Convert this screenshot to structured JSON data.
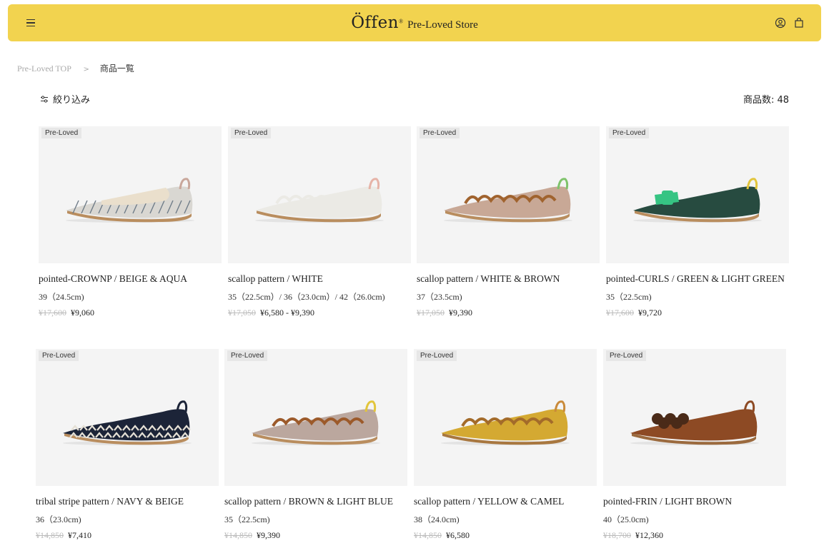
{
  "header": {
    "brand": "Öffen",
    "brand_mark": "®",
    "subtitle": "Pre-Loved Store",
    "bg_color": "#f2d34f"
  },
  "breadcrumb": {
    "home": "Pre-Loved TOP",
    "separator": ">",
    "current": "商品一覧"
  },
  "toolbar": {
    "filter_label": "絞り込み",
    "count_label": "商品数: 48"
  },
  "products": [
    {
      "badge": "Pre-Loved",
      "name": "pointed-CROWNP / BEIGE & AQUA",
      "size": "39（24.5cm)",
      "orig_price": "¥17,600",
      "price": "¥9,060",
      "shoe": "pointed",
      "upper": "#d9d7d2",
      "stripe": "#6f7c88",
      "trim": "#eadfcc",
      "sole": "#b98d5e",
      "tab": "#c9a79b",
      "accent": "none"
    },
    {
      "badge": "Pre-Loved",
      "name": "scallop pattern / WHITE",
      "size": "35（22.5cm）/ 36（23.0cm）/ 42（26.0cm)",
      "orig_price": "¥17,050",
      "price": "¥6,580 - ¥9,390",
      "shoe": "scallop",
      "upper": "#ebeae5",
      "stripe": "#ebeae5",
      "trim": "#ebeae5",
      "sole": "#b98d5e",
      "tab": "#e6b3a7",
      "accent": "none"
    },
    {
      "badge": "Pre-Loved",
      "name": "scallop pattern / WHITE & BROWN",
      "size": "37（23.5cm)",
      "orig_price": "¥17,050",
      "price": "¥9,390",
      "shoe": "scallop",
      "upper": "#c8a896",
      "stripe": "#c8a896",
      "trim": "#a0632e",
      "sole": "#b98d5e",
      "tab": "#7fc36b",
      "accent": "none"
    },
    {
      "badge": "Pre-Loved",
      "name": "pointed-CURLS / GREEN & LIGHT GREEN",
      "size": "35（22.5cm)",
      "orig_price": "¥17,600",
      "price": "¥9,720",
      "shoe": "bow",
      "upper": "#274b40",
      "stripe": "#274b40",
      "trim": "#274b40",
      "sole": "#b98d5e",
      "tab": "#e2c53b",
      "accent": "#36c483"
    },
    {
      "badge": "Pre-Loved",
      "name": "tribal stripe pattern / NAVY & BEIGE",
      "size": "36（23.0cm)",
      "orig_price": "¥14,850",
      "price": "¥7,410",
      "shoe": "zigzag",
      "upper": "#1c2438",
      "stripe": "#e5e0d5",
      "trim": "#1c2438",
      "sole": "#b98d5e",
      "tab": "#1c2438",
      "accent": "none"
    },
    {
      "badge": "Pre-Loved",
      "name": "scallop pattern / BROWN & LIGHT BLUE",
      "size": "35（22.5cm)",
      "orig_price": "¥14,850",
      "price": "¥9,390",
      "shoe": "scallop",
      "upper": "#bba79e",
      "stripe": "#bba79e",
      "trim": "#9c5a2a",
      "sole": "#b98d5e",
      "tab": "#e2c53b",
      "accent": "none"
    },
    {
      "badge": "Pre-Loved",
      "name": "scallop pattern / YELLOW & CAMEL",
      "size": "38（24.0cm)",
      "orig_price": "¥14,850",
      "price": "¥6,580",
      "shoe": "scallop",
      "upper": "#d4a932",
      "stripe": "#d4a932",
      "trim": "#a36b2a",
      "sole": "#a8773f",
      "tab": "#c98a3a",
      "accent": "none"
    },
    {
      "badge": "Pre-Loved",
      "name": "pointed-FRIN / LIGHT BROWN",
      "size": "40（25.0cm)",
      "orig_price": "¥18,700",
      "price": "¥12,360",
      "shoe": "frill",
      "upper": "#8d4a24",
      "stripe": "#8d4a24",
      "trim": "#8d4a24",
      "sole": "#9b6a3e",
      "tab": "#8d4a24",
      "accent": "#4a2a18"
    }
  ]
}
